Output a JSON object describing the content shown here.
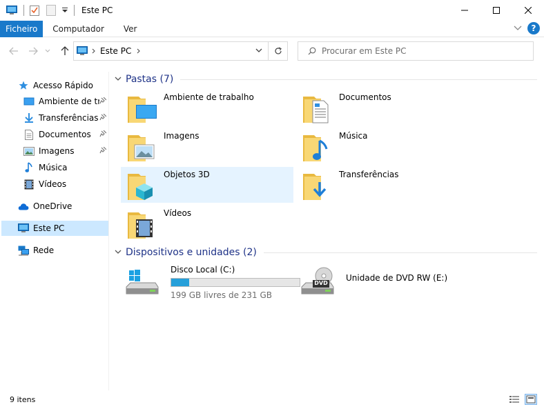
{
  "window": {
    "title": "Este PC"
  },
  "ribbon": {
    "tabs": [
      {
        "label": "Ficheiro"
      },
      {
        "label": "Computador"
      },
      {
        "label": "Ver"
      }
    ],
    "help_label": "?"
  },
  "nav": {
    "address_label": "Este PC",
    "search_placeholder": "Procurar em Este PC"
  },
  "sidebar": {
    "quick_access": "Acesso Rápido",
    "items": [
      {
        "label": "Ambiente de trabalho"
      },
      {
        "label": "Transferências"
      },
      {
        "label": "Documentos"
      },
      {
        "label": "Imagens"
      },
      {
        "label": "Música"
      },
      {
        "label": "Vídeos"
      }
    ],
    "onedrive": "OneDrive",
    "this_pc": "Este PC",
    "network": "Rede"
  },
  "content": {
    "folders_header": "Pastas (7)",
    "folders": [
      {
        "label": "Ambiente de trabalho",
        "icon": "desktop-folder-icon"
      },
      {
        "label": "Documentos",
        "icon": "documents-folder-icon"
      },
      {
        "label": "Imagens",
        "icon": "pictures-folder-icon"
      },
      {
        "label": "Música",
        "icon": "music-folder-icon"
      },
      {
        "label": "Objetos 3D",
        "icon": "3d-objects-folder-icon"
      },
      {
        "label": "Transferências",
        "icon": "downloads-folder-icon"
      },
      {
        "label": "Vídeos",
        "icon": "videos-folder-icon"
      }
    ],
    "devices_header": "Dispositivos e unidades (2)",
    "drives": [
      {
        "label": "Disco Local (C:)",
        "free": "199 GB livres de 231 GB",
        "used_fraction": 0.14
      },
      {
        "label": "Unidade de DVD RW (E:)",
        "badge": "DVD"
      }
    ]
  },
  "status": {
    "items_count": "9 itens"
  },
  "colors": {
    "accent": "#1979ca",
    "folder": "#f8d775",
    "selected": "#cce8ff",
    "hover": "#e5f3ff",
    "header_text": "#1e3287",
    "drive_bar": "#26a0da"
  }
}
